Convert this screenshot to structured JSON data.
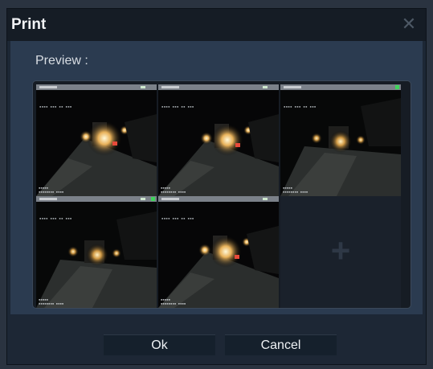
{
  "dialog": {
    "title": "Print",
    "close_icon": "close-icon",
    "preview_label": "Preview :",
    "cameras": [
      {
        "name": "camera-1",
        "selected": true
      },
      {
        "name": "camera-2",
        "selected": false
      },
      {
        "name": "camera-3",
        "selected": false
      },
      {
        "name": "camera-4",
        "selected": false
      },
      {
        "name": "camera-5",
        "selected": false
      }
    ],
    "empty_slot_icon": "plus-icon",
    "ok_label": "Ok",
    "cancel_label": "Cancel"
  },
  "colors": {
    "accent_selected": "#35b84d",
    "background": "#1d2735"
  }
}
